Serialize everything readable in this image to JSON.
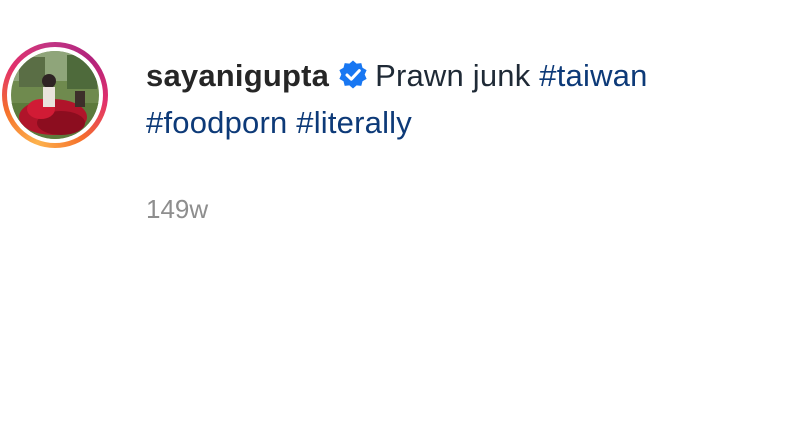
{
  "post": {
    "username": "sayanigupta",
    "caption_text": "Prawn junk",
    "hashtags": [
      "#taiwan",
      "#foodporn",
      "#literally"
    ],
    "timestamp": "149w"
  },
  "icons": {
    "verified": "verified-badge-icon",
    "avatar": "profile-avatar"
  },
  "colors": {
    "hashtag": "#0d3a78",
    "verified": "#1877f2",
    "timestamp": "#8e8e8e",
    "ring_start": "#fdb24c",
    "ring_end": "#c13584"
  }
}
